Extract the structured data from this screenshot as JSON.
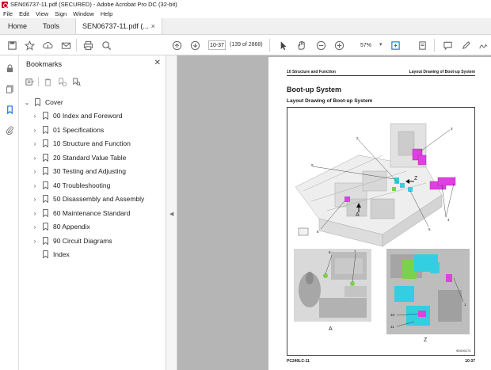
{
  "window": {
    "title": "SEN06737-11.pdf (SECURED) - Adobe Acrobat Pro DC (32-bit)"
  },
  "menu": [
    "File",
    "Edit",
    "View",
    "Sign",
    "Window",
    "Help"
  ],
  "tabs": {
    "home": "Home",
    "tools": "Tools",
    "document": "SEN06737-11.pdf (...",
    "close": "×"
  },
  "toolbar": {
    "page_input": "10-37",
    "page_count": "(139 of 2868)",
    "zoom": "57%"
  },
  "bookmarks": {
    "title": "Bookmarks",
    "close": "✕",
    "items": [
      {
        "label": "Cover",
        "level": 0,
        "expandable": true,
        "expanded": true
      },
      {
        "label": "00 Index and Foreword",
        "level": 1,
        "expandable": true
      },
      {
        "label": "01 Specifications",
        "level": 1,
        "expandable": true
      },
      {
        "label": "10 Structure and Function",
        "level": 1,
        "expandable": true
      },
      {
        "label": "20 Standard Value Table",
        "level": 1,
        "expandable": true
      },
      {
        "label": "30 Testing and Adjusting",
        "level": 1,
        "expandable": true
      },
      {
        "label": "40 Troubleshooting",
        "level": 1,
        "expandable": true
      },
      {
        "label": "50 Disassembly and Assembly",
        "level": 1,
        "expandable": true
      },
      {
        "label": "60 Maintenance Standard",
        "level": 1,
        "expandable": true
      },
      {
        "label": "80 Appendix",
        "level": 1,
        "expandable": true
      },
      {
        "label": "90 Circuit Diagrams",
        "level": 1,
        "expandable": true
      },
      {
        "label": "Index",
        "level": 1,
        "expandable": false
      }
    ]
  },
  "page": {
    "header_left": "10 Structure and Function",
    "header_right": "Layout Drawing of Boot-up System",
    "heading": "Boot-up System",
    "subheading": "Layout Drawing of Boot-up System",
    "footer_left": "PC240LC-11",
    "footer_right": "10-37",
    "figure_id": "9D000174",
    "callouts": [
      "1",
      "2",
      "3",
      "4",
      "5",
      "6",
      "7",
      "8",
      "9",
      "10",
      "11"
    ],
    "view_labels": {
      "a": "A",
      "z": "Z"
    }
  },
  "colors": {
    "accent": "#1473e6",
    "magenta": "#e040e0",
    "cyan": "#33cfe0",
    "green": "#7ad14a"
  }
}
